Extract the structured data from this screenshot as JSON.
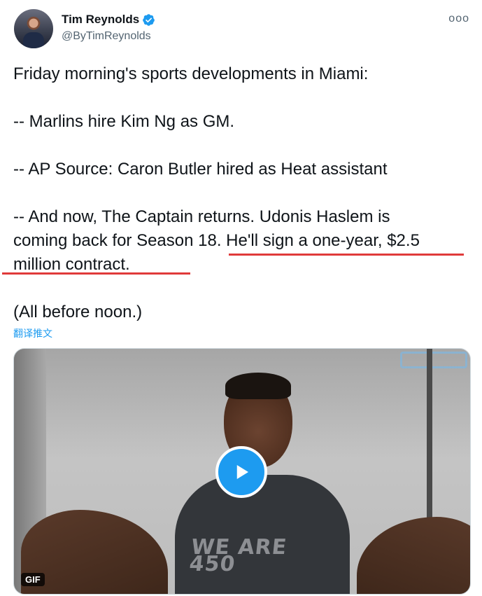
{
  "author": {
    "display_name": "Tim Reynolds",
    "handle": "@ByTimReynolds",
    "verified": true,
    "avatar_icon": "avatar-photo"
  },
  "more_menu": {
    "label": "ooo",
    "icon": "more-horizontal-icon"
  },
  "tweet": {
    "line1": "Friday morning's sports developments in Miami:",
    "line2": "-- Marlins hire Kim Ng as GM.",
    "line3": "-- AP Source: Caron Butler hired as Heat assistant",
    "line4": "-- And now, The Captain returns. Udonis Haslem is",
    "line5": "coming back for Season 18. He'll sign a one-year, $2.5",
    "line6": "million contract.",
    "line7": "(All before noon.)"
  },
  "translate_label": "翻译推文",
  "media": {
    "badge": "GIF",
    "shirt_line1": "WE ARE",
    "shirt_line2": "450",
    "play_icon": "play-icon"
  },
  "colors": {
    "accent": "#1d9bf0",
    "underline": "#e03a3a",
    "secondary_text": "#536471"
  }
}
